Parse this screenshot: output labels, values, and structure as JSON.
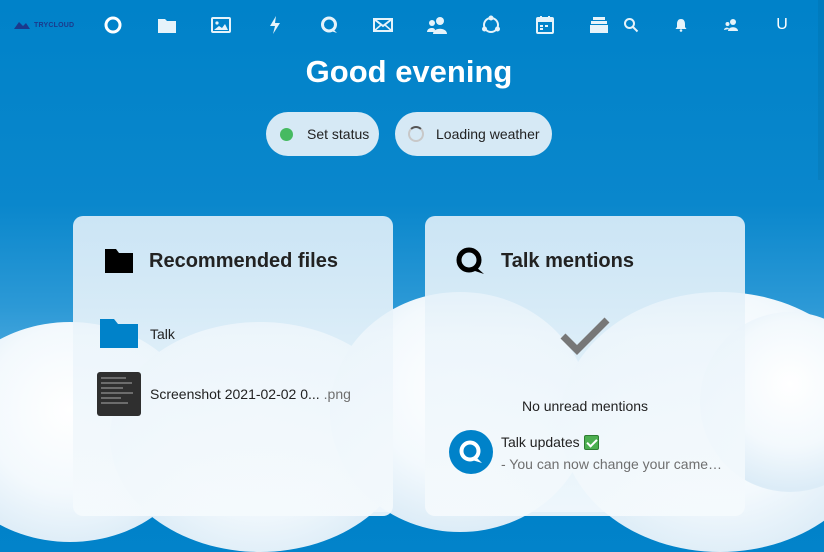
{
  "app": {
    "logo_text": "TRYCLOUD",
    "avatar_letter": "U",
    "brand_color": "#0082c9"
  },
  "nav": {
    "apps": [
      {
        "name": "dashboard",
        "icon": "dashboard-circle-icon"
      },
      {
        "name": "files",
        "icon": "folder-icon"
      },
      {
        "name": "photos",
        "icon": "image-icon"
      },
      {
        "name": "activity",
        "icon": "lightning-icon"
      },
      {
        "name": "talk",
        "icon": "talk-bubble-icon"
      },
      {
        "name": "mail",
        "icon": "envelope-icon"
      },
      {
        "name": "contacts",
        "icon": "contacts-icon"
      },
      {
        "name": "circles",
        "icon": "circles-icon"
      },
      {
        "name": "calendar",
        "icon": "calendar-icon"
      },
      {
        "name": "deck",
        "icon": "deck-icon"
      }
    ],
    "right_icons": [
      "search-icon",
      "bell-icon",
      "contacts-menu-icon"
    ]
  },
  "greeting": "Good evening",
  "status_button": {
    "label": "Set status",
    "dot_color": "#46ba61"
  },
  "weather_button": {
    "label": "Loading weather"
  },
  "recommended": {
    "title": "Recommended files",
    "items": [
      {
        "name": "Talk",
        "ext": "",
        "type": "folder"
      },
      {
        "name": "Screenshot 2021-02-02 0...",
        "ext": ".png",
        "type": "image"
      }
    ]
  },
  "talk": {
    "title": "Talk mentions",
    "empty_text": "No unread mentions",
    "items": [
      {
        "title": "Talk updates",
        "subtitle": "- You can now change your camer..."
      }
    ]
  }
}
